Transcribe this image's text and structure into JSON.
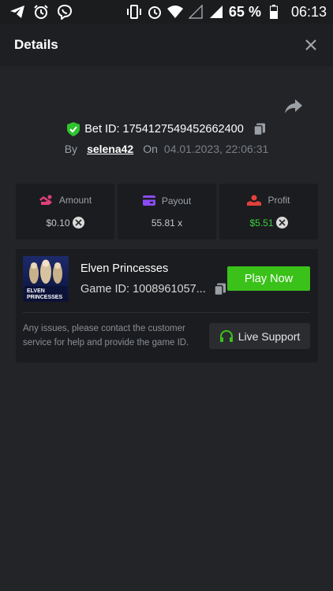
{
  "status_bar": {
    "left_icons": [
      "telegram-icon",
      "alarm-icon",
      "viber-icon"
    ],
    "right_icons": [
      "vibrate-icon",
      "alarm-icon",
      "wifi-icon",
      "signal-empty-icon",
      "signal-icon"
    ],
    "battery": "65 %",
    "time": "06:13"
  },
  "header": {
    "title": "Details",
    "close_icon": "close-icon"
  },
  "bet": {
    "id_label": "Bet ID: 1754127549452662400",
    "by_label": "By",
    "user": "selena42",
    "on_label": "On",
    "date": "04.01.2023, 22:06:31"
  },
  "stats": [
    {
      "icon": "amount-icon",
      "label": "Amount",
      "value": "$0.10",
      "color": "#e0407a"
    },
    {
      "icon": "payout-icon",
      "label": "Payout",
      "value": "55.81 x",
      "color": "#8a4af3"
    },
    {
      "icon": "profit-icon",
      "label": "Profit",
      "value": "$5.51",
      "color": "#e2403b"
    }
  ],
  "game": {
    "title": "Elven Princesses",
    "id_label": "Game ID: 1008961057...",
    "play_label": "Play Now",
    "thumb_text_1": "ELVEN",
    "thumb_text_2": "PRINCESSES",
    "support_text": "Any issues, please contact the customer service for help and provide the game ID.",
    "support_label": "Live Support"
  },
  "colors": {
    "background": "#232427",
    "accent_green": "#3ac11a",
    "profit_green": "#3ecf3e"
  }
}
